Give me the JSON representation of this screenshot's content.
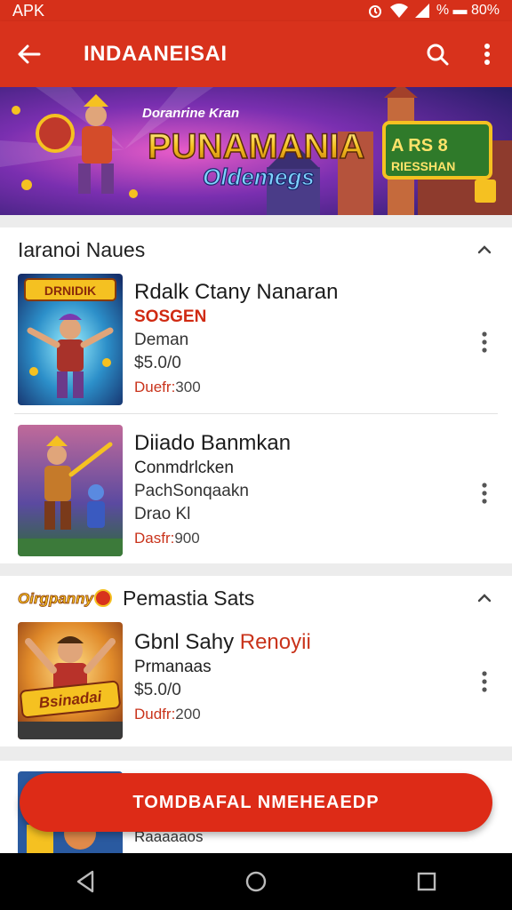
{
  "status_bar": {
    "left_text": "APK",
    "right_text": "% ▬ 80%"
  },
  "app_bar": {
    "title": "INDAANEISAI"
  },
  "banner": {
    "title_line1": "Doranrine Kran",
    "title_line2": "PUNAMANIA",
    "title_line3": "Oldemegs",
    "sign_line1": "A RS 8",
    "sign_line2": "RIESSHAN"
  },
  "section1": {
    "title": "Iaranoi Naues",
    "items": [
      {
        "thumb_label": "DRNIDIK",
        "name": "Rdalk Ctany Nanaran",
        "line2": "SOSGEN",
        "line3": "Deman",
        "line4": "$5.0/0",
        "meta_key": "Duefr:",
        "meta_value": "300"
      },
      {
        "thumb_label": "",
        "name": "Diiado Banmkan",
        "line2": "Conmdrlcken",
        "line3": "PachSonqaakn",
        "line4": "Drao Kl",
        "meta_key": "Dasfr:",
        "meta_value": "900"
      }
    ]
  },
  "section2": {
    "logo_text": "Oirgpanny",
    "title": "Pemastia Sats",
    "items": [
      {
        "thumb_label": "Bsinadai",
        "name_prefix": "Gbnl Sahy ",
        "name_suffix": "Renoyii",
        "line2": "Prmanaas",
        "line3": "$5.0/0",
        "meta_key": "Dudfr:",
        "meta_value": "200"
      }
    ]
  },
  "section3": {
    "peek_text": "Raaaaaos"
  },
  "cta": {
    "label": "TOMDBAFAL NMEHEAEDP"
  },
  "colors": {
    "primary": "#d8321c",
    "accent_text": "#c9331b"
  }
}
